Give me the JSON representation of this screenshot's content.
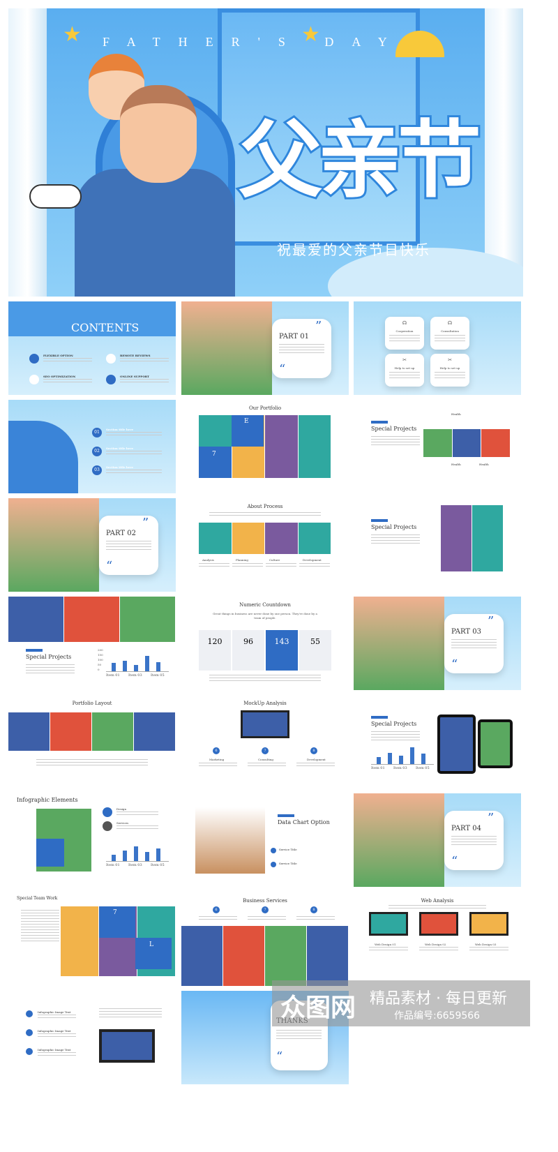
{
  "hero": {
    "title_en": "FATHER'S DAY",
    "title_cn": "父亲节",
    "subtitle": "祝最爱的父亲节日快乐"
  },
  "colors": {
    "primary": "#2f6cc4",
    "sky": "#5aaef0",
    "sun": "#f8c93a"
  },
  "slides": [
    {
      "type": "contents",
      "title": "CONTENTS",
      "items": [
        "FLEXIBLE OPTION",
        "REMOTE REVIEWS",
        "SEO OPTIMIZATION",
        "ONLINE SUPPORT"
      ]
    },
    {
      "type": "part",
      "title": "PART 01"
    },
    {
      "type": "cards",
      "items": [
        "Cooperation",
        "Consultation",
        "Help to set up",
        "Help to set up"
      ]
    },
    {
      "type": "sections",
      "items": [
        "01",
        "02",
        "03"
      ],
      "label": "Section title here"
    },
    {
      "type": "portfolio",
      "title": "Our Portfolio",
      "letter": "E",
      "num": "7"
    },
    {
      "type": "special",
      "title": "Special Projects",
      "labels": [
        "Health",
        "Health",
        "Health"
      ]
    },
    {
      "type": "part",
      "title": "PART 02"
    },
    {
      "type": "process",
      "title": "About Process",
      "steps": [
        "Analysis",
        "Planning",
        "Culture",
        "Development"
      ]
    },
    {
      "type": "special2",
      "title": "Special Projects"
    },
    {
      "type": "chart",
      "title": "Special Projects",
      "axis": [
        "Item 01",
        "Item 03",
        "Item 05"
      ],
      "yticks": [
        "200",
        "150",
        "100",
        "50",
        "0"
      ],
      "bars": [
        80,
        100,
        60,
        150,
        90
      ]
    },
    {
      "type": "numeric",
      "title": "Numeric Countdown",
      "lead": "Great things in business are never done by one person. They're done by a team of people.",
      "values": [
        "120",
        "96",
        "143",
        "55"
      ]
    },
    {
      "type": "part",
      "title": "PART 03"
    },
    {
      "type": "layout",
      "title": "Portfolio Layout"
    },
    {
      "type": "mockup",
      "title": "MockUp Analysis",
      "steps": [
        "Marketing",
        "Consulting",
        "Development"
      ],
      "nums": [
        "6",
        "7",
        "8"
      ]
    },
    {
      "type": "tablet",
      "title": "Special Projects",
      "axis": [
        "Item 01",
        "Item 03",
        "Item 05"
      ],
      "bars": [
        70,
        110,
        80,
        160,
        100
      ]
    },
    {
      "type": "infographic",
      "title": "Infographic Elements",
      "items": [
        "Design",
        "Services"
      ],
      "axis": [
        "Item 01",
        "Item 03",
        "Item 05"
      ],
      "bars": [
        60,
        100,
        140,
        90,
        120
      ]
    },
    {
      "type": "datachart",
      "title": "Data Chart Option",
      "items": [
        "Service Title",
        "Service Title"
      ]
    },
    {
      "type": "part",
      "title": "PART 04"
    },
    {
      "type": "team",
      "title": "Special Team Work",
      "num": "7",
      "letter": "L"
    },
    {
      "type": "business",
      "title": "Business Services",
      "nums": [
        "6",
        "7",
        "8"
      ]
    },
    {
      "type": "web",
      "title": "Web Analysis",
      "items": [
        "Web Design 01",
        "Web Design 02",
        "Web Design 03"
      ]
    },
    {
      "type": "list",
      "items": [
        "Infographic Image Text",
        "Infographic Image Text",
        "Infographic Image Text"
      ]
    },
    {
      "type": "thanks",
      "title": "THANKS"
    }
  ],
  "watermark": {
    "logo": "众图网",
    "slogan": "精品素材 · 每日更新",
    "code": "作品编号:6659566"
  }
}
